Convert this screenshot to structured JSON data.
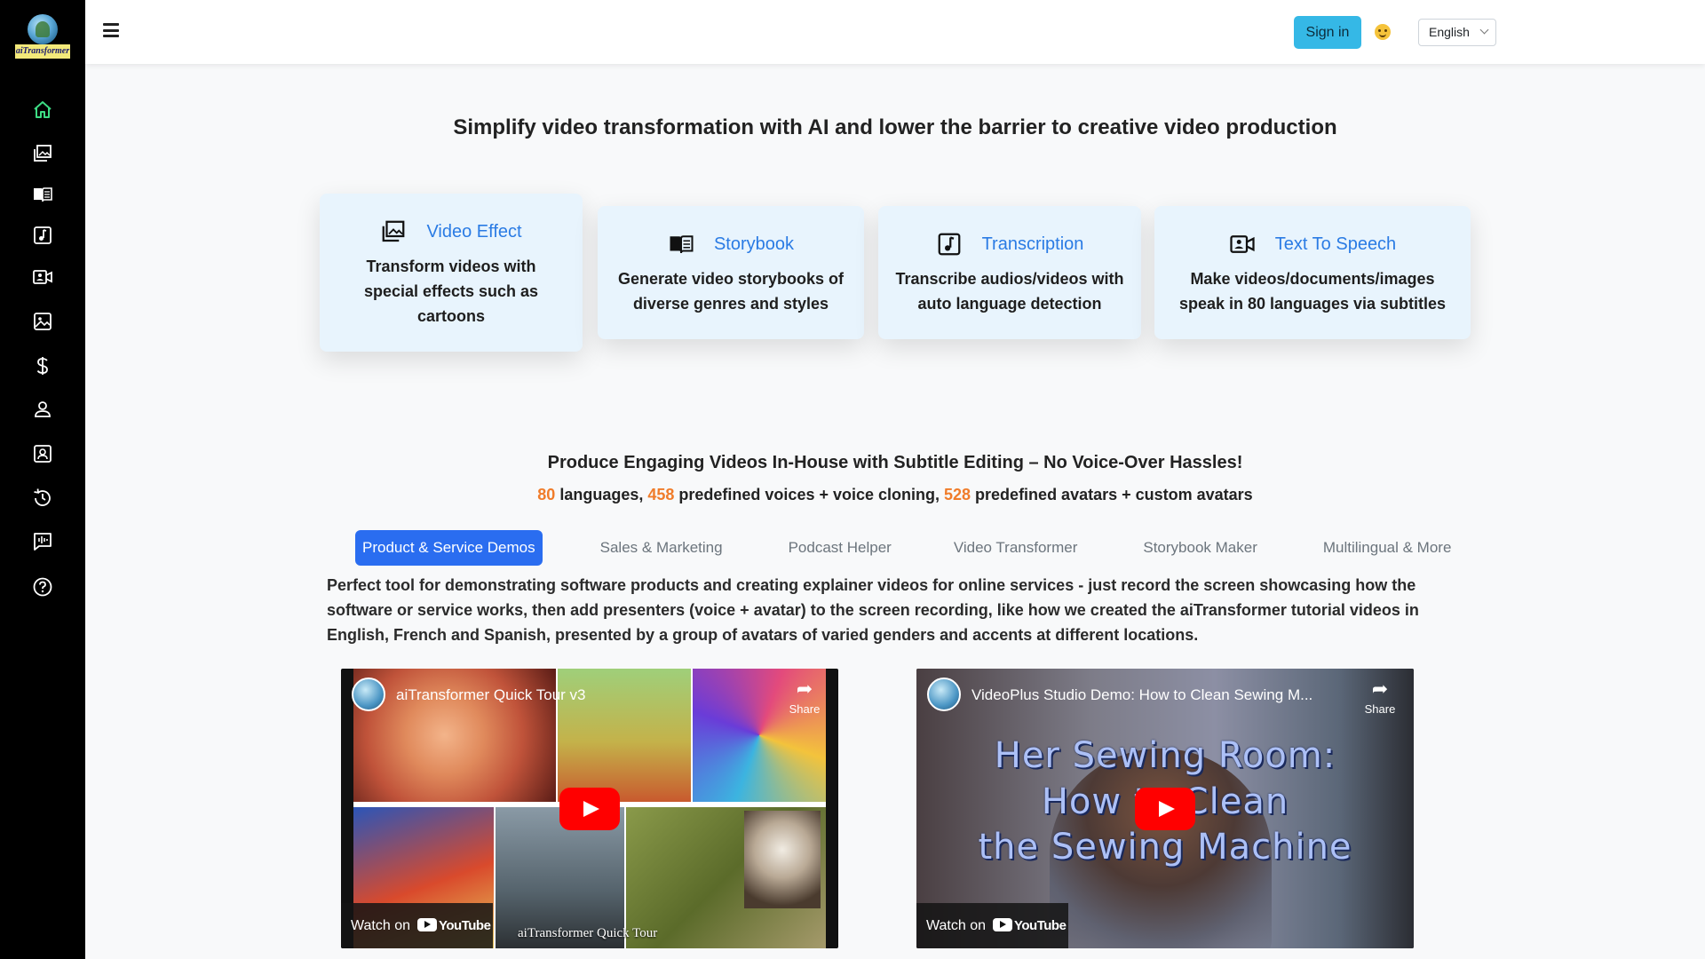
{
  "app": {
    "logo_text": "aiTransformer"
  },
  "sidebar": {
    "items": [
      {
        "name": "home",
        "icon": "home-icon"
      },
      {
        "name": "video-effect",
        "icon": "images-icon"
      },
      {
        "name": "storybook",
        "icon": "book-icon"
      },
      {
        "name": "transcription",
        "icon": "music-note-icon"
      },
      {
        "name": "text-to-speech",
        "icon": "camera-video-icon"
      },
      {
        "name": "image",
        "icon": "image-icon"
      },
      {
        "name": "pricing",
        "icon": "dollar-icon"
      },
      {
        "name": "account",
        "icon": "person-icon"
      },
      {
        "name": "profile",
        "icon": "person-badge-icon"
      },
      {
        "name": "history",
        "icon": "history-icon"
      },
      {
        "name": "feedback",
        "icon": "chat-voice-icon"
      },
      {
        "name": "help",
        "icon": "question-circle-icon"
      }
    ],
    "active_color": "#3ddc84"
  },
  "header": {
    "sign_in_label": "Sign in",
    "language": "English"
  },
  "hero": {
    "headline": "Simplify video transformation with AI and lower the barrier to creative video production"
  },
  "features": [
    {
      "title": "Video Effect",
      "description": "Transform videos with special effects such as cartoons",
      "icon": "images-icon"
    },
    {
      "title": "Storybook",
      "description": "Generate video storybooks of diverse genres and styles",
      "icon": "book-icon"
    },
    {
      "title": "Transcription",
      "description": "Transcribe audios/videos with auto language detection",
      "icon": "music-note-icon"
    },
    {
      "title": "Text To Speech",
      "description": "Make videos/documents/images speak in 80 languages via subtitles",
      "icon": "camera-video-icon"
    }
  ],
  "section": {
    "heading": "Produce Engaging Videos In-House with Subtitle Editing – No Voice-Over Hassles!",
    "stats": {
      "languages_count": "80",
      "languages_text": " languages, ",
      "voices_count": "458",
      "voices_text": " predefined voices + voice cloning, ",
      "avatars_count": "528",
      "avatars_text": " predefined avatars + custom avatars"
    },
    "tabs": [
      {
        "label": "Product & Service Demos",
        "active": true
      },
      {
        "label": "Sales & Marketing",
        "active": false
      },
      {
        "label": "Podcast Helper",
        "active": false
      },
      {
        "label": "Video Transformer",
        "active": false
      },
      {
        "label": "Storybook Maker",
        "active": false
      },
      {
        "label": "Multilingual & More",
        "active": false
      }
    ],
    "description": "Perfect tool for demonstrating software products and creating explainer videos for online services - just record the screen showcasing how the software or service works, then add presenters (voice + avatar) to the screen recording, like how we created the aiTransformer tutorial videos in English, French and Spanish, presented by a group of avatars of varied genders and accents at different locations."
  },
  "videos": [
    {
      "title": "aiTransformer Quick Tour v3",
      "share_label": "Share",
      "watch_label": "Watch on",
      "youtube_label": "YouTube",
      "caption": "aiTransformer Quick Tour"
    },
    {
      "title": "VideoPlus Studio Demo: How to Clean Sewing M...",
      "share_label": "Share",
      "watch_label": "Watch on",
      "youtube_label": "YouTube",
      "overlay_lines": [
        "Her Sewing Room:",
        "How to Clean",
        "the Sewing Machine"
      ]
    }
  ],
  "colors": {
    "accent": "#2a6df0",
    "link": "#2a7be4",
    "highlight": "#f07c2a",
    "signin": "#35b8e6",
    "card": "#e8f4fd"
  }
}
